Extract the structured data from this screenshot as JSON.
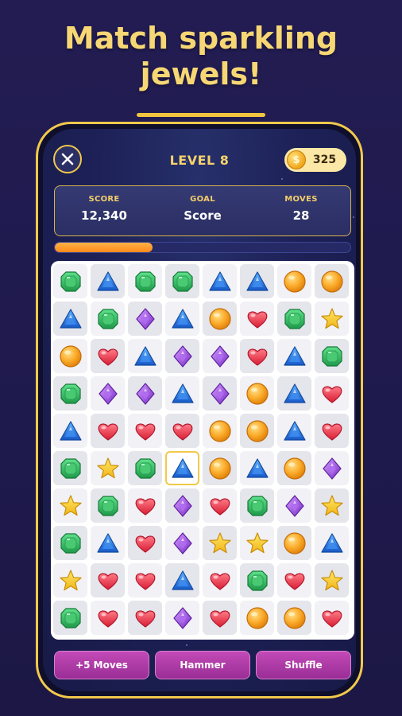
{
  "headline": {
    "line1": "Match sparkling",
    "line2": "jewels!"
  },
  "game": {
    "level_title": "LEVEL 8",
    "coins": "325",
    "coin_symbol": "$",
    "stats": [
      {
        "label": "SCORE",
        "value": "12,340"
      },
      {
        "label": "GOAL",
        "value": "Score"
      },
      {
        "label": "MOVES",
        "value": "28"
      }
    ],
    "goal_progress": 0.33,
    "selected_cell": [
      5,
      3
    ],
    "board": [
      [
        "green-emerald",
        "blue-triangle",
        "green-emerald",
        "green-emerald",
        "blue-triangle",
        "blue-triangle",
        "orange-orb",
        "orange-orb"
      ],
      [
        "blue-triangle",
        "green-emerald",
        "purple-diamond",
        "blue-triangle",
        "orange-orb",
        "red-heart",
        "green-emerald",
        "yellow-star"
      ],
      [
        "orange-orb",
        "red-heart",
        "blue-triangle",
        "purple-diamond",
        "purple-diamond",
        "red-heart",
        "blue-triangle",
        "green-emerald"
      ],
      [
        "green-emerald",
        "purple-diamond",
        "purple-diamond",
        "blue-triangle",
        "purple-diamond",
        "orange-orb",
        "blue-triangle",
        "red-heart"
      ],
      [
        "blue-triangle",
        "red-heart",
        "red-heart",
        "red-heart",
        "orange-orb",
        "orange-orb",
        "blue-triangle",
        "red-heart"
      ],
      [
        "green-emerald",
        "yellow-star",
        "green-emerald",
        "blue-triangle",
        "orange-orb",
        "blue-triangle",
        "orange-orb",
        "purple-diamond"
      ],
      [
        "yellow-star",
        "green-emerald",
        "red-heart",
        "purple-diamond",
        "red-heart",
        "green-emerald",
        "purple-diamond",
        "yellow-star"
      ],
      [
        "green-emerald",
        "blue-triangle",
        "red-heart",
        "purple-diamond",
        "yellow-star",
        "yellow-star",
        "orange-orb",
        "blue-triangle"
      ],
      [
        "yellow-star",
        "red-heart",
        "red-heart",
        "blue-triangle",
        "red-heart",
        "green-emerald",
        "red-heart",
        "yellow-star"
      ],
      [
        "green-emerald",
        "red-heart",
        "red-heart",
        "purple-diamond",
        "red-heart",
        "orange-orb",
        "orange-orb",
        "red-heart"
      ]
    ],
    "boosters": [
      {
        "label": "+5 Moves"
      },
      {
        "label": "Hammer"
      },
      {
        "label": "Shuffle"
      }
    ]
  },
  "colors": {
    "headline": "#f7d774",
    "frame": "#f2c94c",
    "booster": "#b03ea8",
    "progress": "#ff961f"
  },
  "icons": {
    "close": "close-icon",
    "coin": "coin-icon"
  }
}
